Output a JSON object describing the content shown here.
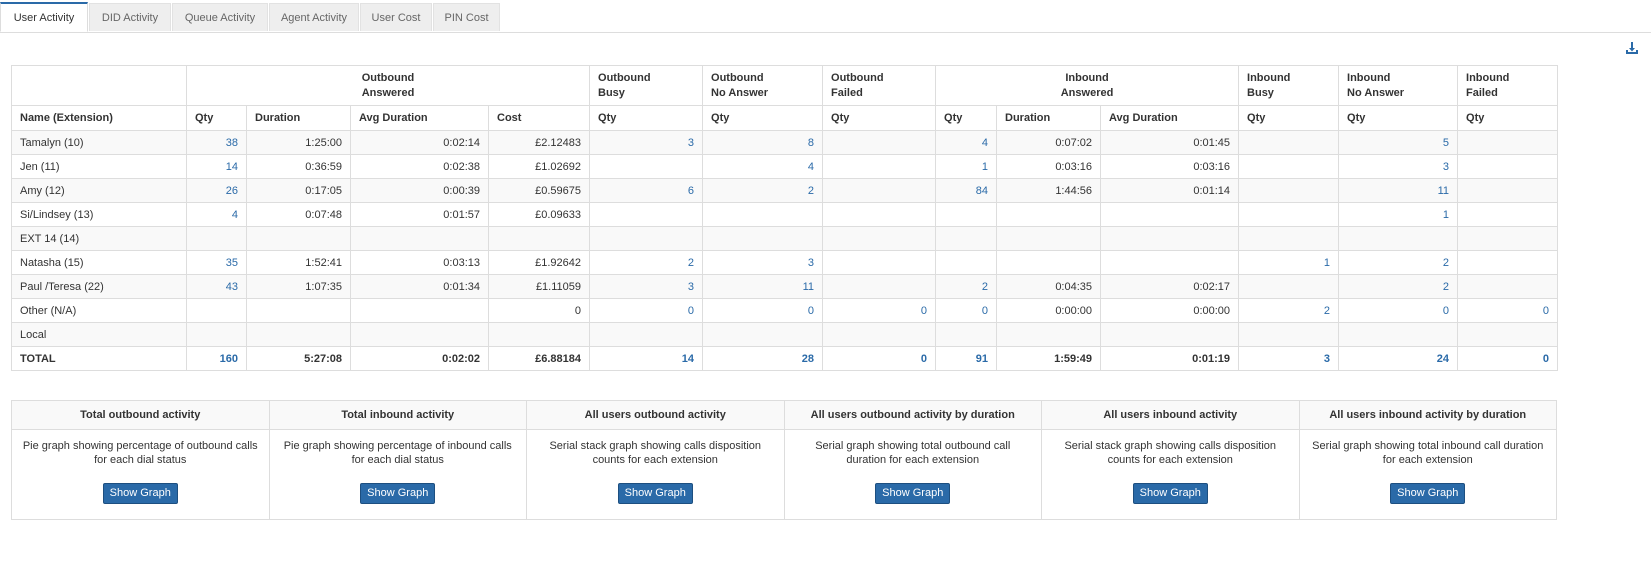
{
  "tabs": [
    {
      "label": "User Activity",
      "active": true
    },
    {
      "label": "DID Activity",
      "active": false
    },
    {
      "label": "Queue Activity",
      "active": false
    },
    {
      "label": "Agent Activity",
      "active": false
    },
    {
      "label": "User Cost",
      "active": false
    },
    {
      "label": "PIN Cost",
      "active": false
    }
  ],
  "download_icon": "download-icon",
  "report": {
    "groups": {
      "outbound_answered": "Outbound\nAnswered",
      "outbound_busy": "Outbound\nBusy",
      "outbound_no_answer": "Outbound\nNo Answer",
      "outbound_failed": "Outbound\nFailed",
      "inbound_answered": "Inbound\nAnswered",
      "inbound_busy": "Inbound\nBusy",
      "inbound_no_answer": "Inbound\nNo Answer",
      "inbound_failed": "Inbound\nFailed"
    },
    "columns": [
      "Name (Extension)",
      "Qty",
      "Duration",
      "Avg Duration",
      "Cost",
      "Qty",
      "Qty",
      "Qty",
      "Qty",
      "Duration",
      "Avg Duration",
      "Qty",
      "Qty",
      "Qty"
    ],
    "rows": [
      [
        "Tamalyn (10)",
        "38",
        "1:25:00",
        "0:02:14",
        "£2.12483",
        "3",
        "8",
        "",
        "4",
        "0:07:02",
        "0:01:45",
        "",
        "5",
        ""
      ],
      [
        "Jen (11)",
        "14",
        "0:36:59",
        "0:02:38",
        "£1.02692",
        "",
        "4",
        "",
        "1",
        "0:03:16",
        "0:03:16",
        "",
        "3",
        ""
      ],
      [
        "Amy (12)",
        "26",
        "0:17:05",
        "0:00:39",
        "£0.59675",
        "6",
        "2",
        "",
        "84",
        "1:44:56",
        "0:01:14",
        "",
        "11",
        ""
      ],
      [
        "Si/Lindsey (13)",
        "4",
        "0:07:48",
        "0:01:57",
        "£0.09633",
        "",
        "",
        "",
        "",
        "",
        "",
        "",
        "1",
        ""
      ],
      [
        "EXT 14 (14)",
        "",
        "",
        "",
        "",
        "",
        "",
        "",
        "",
        "",
        "",
        "",
        "",
        ""
      ],
      [
        "Natasha (15)",
        "35",
        "1:52:41",
        "0:03:13",
        "£1.92642",
        "2",
        "3",
        "",
        "",
        "",
        "",
        "1",
        "2",
        ""
      ],
      [
        "Paul /Teresa (22)",
        "43",
        "1:07:35",
        "0:01:34",
        "£1.11059",
        "3",
        "11",
        "",
        "2",
        "0:04:35",
        "0:02:17",
        "",
        "2",
        ""
      ],
      [
        "Other (N/A)",
        "",
        "",
        "",
        "0",
        "0",
        "0",
        "0",
        "0",
        "0:00:00",
        "0:00:00",
        "2",
        "0",
        "0"
      ],
      [
        "Local",
        "",
        "",
        "",
        "",
        "",
        "",
        "",
        "",
        "",
        "",
        "",
        "",
        ""
      ]
    ],
    "total": [
      "TOTAL",
      "160",
      "5:27:08",
      "0:02:02",
      "£6.88184",
      "14",
      "28",
      "0",
      "91",
      "1:59:49",
      "0:01:19",
      "3",
      "24",
      "0"
    ]
  },
  "graphs": [
    {
      "title": "Total outbound activity",
      "desc": "Pie graph showing percentage of outbound calls for each dial status",
      "button": "Show Graph"
    },
    {
      "title": "Total inbound activity",
      "desc": "Pie graph showing percentage of inbound calls for each dial status",
      "button": "Show Graph"
    },
    {
      "title": "All users outbound activity",
      "desc": "Serial stack graph showing calls disposition counts for each extension",
      "button": "Show Graph"
    },
    {
      "title": "All users outbound activity by duration",
      "desc": "Serial graph showing total outbound call duration for each extension",
      "button": "Show Graph"
    },
    {
      "title": "All users inbound activity",
      "desc": "Serial stack graph showing calls disposition counts for each extension",
      "button": "Show Graph"
    },
    {
      "title": "All users inbound activity by duration",
      "desc": "Serial graph showing total inbound call duration for each extension",
      "button": "Show Graph"
    }
  ]
}
